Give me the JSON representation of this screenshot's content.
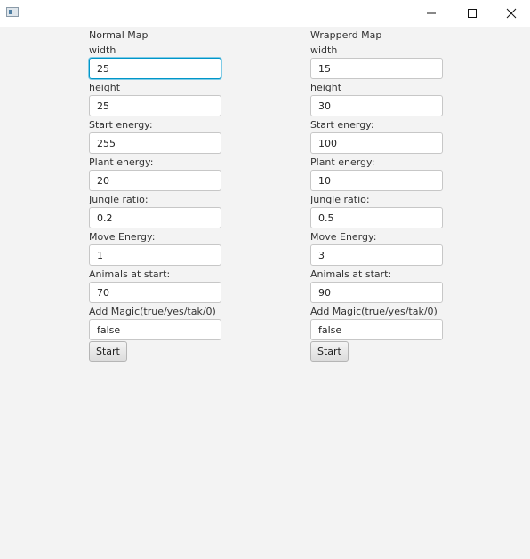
{
  "window": {
    "app_icon": "java-window-icon",
    "controls": [
      "minimize-icon",
      "maximize-icon",
      "close-icon"
    ]
  },
  "normal_map": {
    "title": "Normal Map",
    "labels": {
      "width": "width",
      "height": "height",
      "start_energy": "Start energy:",
      "plant_energy": "Plant energy:",
      "jungle_ratio": "Jungle ratio:",
      "move_energy": "Move Energy:",
      "animals_at_start": "Animals at start:",
      "add_magic": "Add Magic(true/yes/tak/0)"
    },
    "values": {
      "width": "25",
      "height": "25",
      "start_energy": "255",
      "plant_energy": "20",
      "jungle_ratio": "0.2",
      "move_energy": "1",
      "animals_at_start": "70",
      "add_magic": "false"
    },
    "start_label": "Start"
  },
  "wrapped_map": {
    "title": "Wrapperd Map",
    "labels": {
      "width": "width",
      "height": "height",
      "start_energy": "Start energy:",
      "plant_energy": "Plant energy:",
      "jungle_ratio": "Jungle ratio:",
      "move_energy": "Move Energy:",
      "animals_at_start": "Animals at start:",
      "add_magic": "Add Magic(true/yes/tak/0)"
    },
    "values": {
      "width": "15",
      "height": "30",
      "start_energy": "100",
      "plant_energy": "10",
      "jungle_ratio": "0.5",
      "move_energy": "3",
      "animals_at_start": "90",
      "add_magic": "false"
    },
    "start_label": "Start"
  },
  "colors": {
    "background": "#f3f3f3",
    "focus_border": "#0096c9",
    "input_border": "#c7c7c7"
  }
}
